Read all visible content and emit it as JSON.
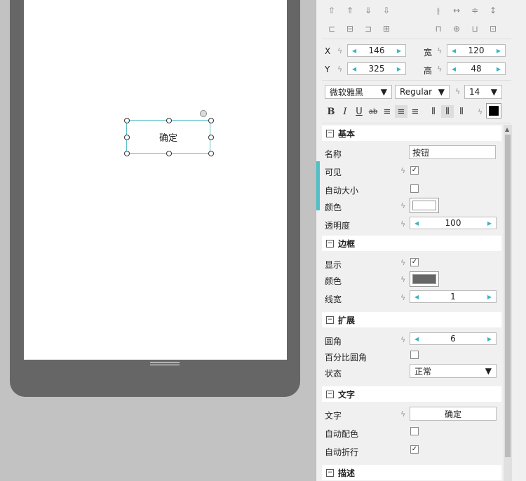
{
  "canvas": {
    "button_text": "确定"
  },
  "geometry": {
    "x_label": "X",
    "x_value": "146",
    "y_label": "Y",
    "y_value": "325",
    "w_label": "宽",
    "w_value": "120",
    "h_label": "高",
    "h_value": "48"
  },
  "font": {
    "family": "微软雅黑",
    "weight": "Regular",
    "size": "14"
  },
  "format": {
    "bold": "B",
    "italic": "I",
    "underline": "U",
    "strike": "ab"
  },
  "sections": {
    "basic": {
      "title": "基本",
      "name_label": "名称",
      "name_value": "按钮",
      "visible_label": "可见",
      "visible_checked": "✓",
      "autosize_label": "自动大小",
      "color_label": "颜色",
      "color_value": "#ffffff",
      "opacity_label": "透明度",
      "opacity_value": "100"
    },
    "border": {
      "title": "边框",
      "show_label": "显示",
      "show_checked": "✓",
      "color_label": "颜色",
      "color_value": "#666666",
      "width_label": "线宽",
      "width_value": "1"
    },
    "extend": {
      "title": "扩展",
      "radius_label": "圆角",
      "radius_value": "6",
      "pct_radius_label": "百分比圆角",
      "state_label": "状态",
      "state_value": "正常"
    },
    "text": {
      "title": "文字",
      "text_label": "文字",
      "text_value": "确定",
      "autocolor_label": "自动配色",
      "wrap_label": "自动折行",
      "wrap_checked": "✓"
    },
    "desc": {
      "title": "描述"
    }
  },
  "colors": {
    "accent": "#4fc0c8",
    "text_color_swatch": "#000000"
  }
}
